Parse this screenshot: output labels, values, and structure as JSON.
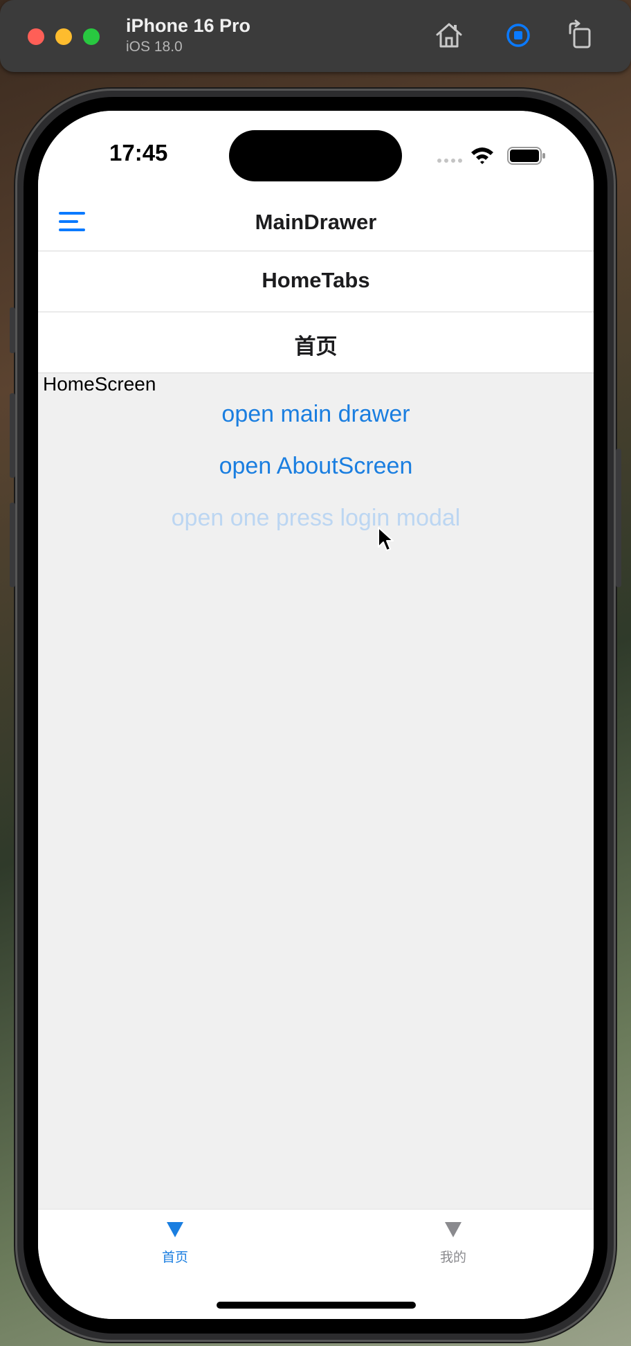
{
  "simulator": {
    "device_name": "iPhone 16 Pro",
    "os_version": "iOS 18.0",
    "toolbar_icons": [
      "home-icon",
      "screenshot-record-icon",
      "rotate-icon"
    ],
    "accent": "#0a7aff"
  },
  "status_bar": {
    "time": "17:45",
    "icons": [
      "cellular-signal-icon",
      "wifi-icon",
      "battery-icon"
    ]
  },
  "navigation": {
    "drawer_title": "MainDrawer",
    "tabs_title": "HomeTabs",
    "screen_title": "首页",
    "menu_icon": "hamburger-menu-icon"
  },
  "home_screen": {
    "label": "HomeScreen",
    "buttons": {
      "open_main_drawer": "open main drawer",
      "open_about_screen": "open AboutScreen",
      "open_login_modal": "open one press login modal"
    }
  },
  "tab_bar": {
    "tabs": [
      {
        "label": "首页",
        "icon": "triangle-down-icon",
        "active": true,
        "color": "#1a7ee0"
      },
      {
        "label": "我的",
        "icon": "triangle-down-icon",
        "active": false,
        "color": "#8a8a8e"
      }
    ]
  }
}
